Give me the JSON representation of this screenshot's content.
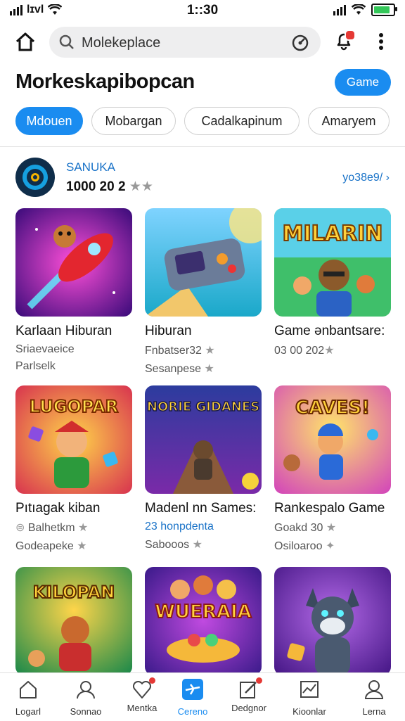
{
  "status": {
    "time": "1::30",
    "carrier": "lɪvl"
  },
  "search": {
    "placeholder": "Molekeplace"
  },
  "page": {
    "title": "Morkeskapibopcan",
    "action_label": "Game"
  },
  "tabs": [
    {
      "label": "Mdouen",
      "active": true
    },
    {
      "label": "Mobargan",
      "active": false
    },
    {
      "label": "Cadalkapinum",
      "active": false
    },
    {
      "label": "Amaryem",
      "active": false
    }
  ],
  "developer": {
    "name": "SANUKA",
    "stats": "1000 20 2",
    "stars": "★★",
    "link": "yo38e9/ ›"
  },
  "cards": [
    {
      "name": "Karlaan Hiburan",
      "line2": "Sriaevaeice",
      "line3": "Parlselk",
      "icon": "rocket-bear-art"
    },
    {
      "name": "Hiburan",
      "line2": "Fnbatser32",
      "line3": "Sesanpese",
      "icon": "arcade-machine-art"
    },
    {
      "name": "Game ənbantsare:",
      "line2": "03 00 202",
      "line3": "",
      "icon": "milarin-heroes-art"
    },
    {
      "name": "Pıtıagak kiban",
      "line2": "Balhetkm",
      "line3": "Godeapeke",
      "icon": "lugopar-jester-art"
    },
    {
      "name": "Madenl nn Sames:",
      "line2": "23 honpdenta",
      "line3": "Sabooos",
      "icon": "nories-runner-art"
    },
    {
      "name": "Rankespalo Game",
      "line2": "Goakd 30",
      "line3": "Osiloaroo",
      "icon": "caves-hero-art"
    },
    {
      "name": "",
      "line2": "",
      "line3": "",
      "icon": "kilopan-bear-art"
    },
    {
      "name": "",
      "line2": "",
      "line3": "",
      "icon": "wueraia-party-art"
    },
    {
      "name": "",
      "line2": "",
      "line3": "",
      "icon": "wolf-mascot-art"
    }
  ],
  "card_art_text": [
    "MILARIN",
    "LUGOPAR",
    "NORIE GIDANES",
    "CAVES!",
    "KILOPAN",
    "WUERAIA"
  ],
  "nav": [
    {
      "label": "Logarl",
      "icon": "home-icon"
    },
    {
      "label": "Sonnao",
      "icon": "profile-icon"
    },
    {
      "label": "Mentka",
      "icon": "heart-icon"
    },
    {
      "label": "Cereno",
      "icon": "airplane-icon"
    },
    {
      "label": "Dedgnor",
      "icon": "edit-icon"
    },
    {
      "label": "Kioonlar",
      "icon": "chart-icon"
    },
    {
      "label": "Lerna",
      "icon": "user-icon"
    }
  ],
  "colors": {
    "accent": "#1a8cf0",
    "badge": "#e53935",
    "link": "#1a73c8"
  }
}
